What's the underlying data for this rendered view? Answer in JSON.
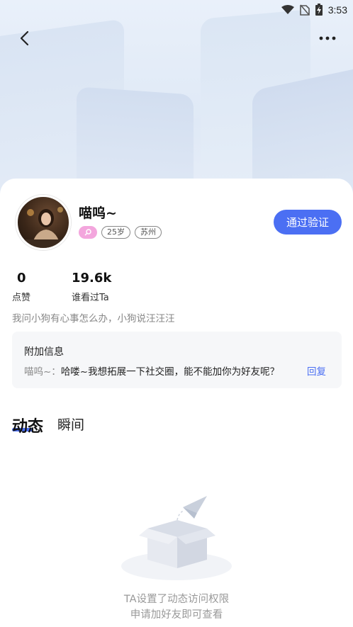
{
  "status_bar": {
    "time": "3:53"
  },
  "profile": {
    "nickname": "喵呜~",
    "age_tag": "25岁",
    "city_tag": "苏州",
    "bio": "我问小狗有心事怎么办，小狗说汪汪汪"
  },
  "actions": {
    "verify_label": "通过验证"
  },
  "stats": [
    {
      "value": "0",
      "label": "点赞"
    },
    {
      "value": "19.6k",
      "label": "谁看过Ta"
    }
  ],
  "extra_info": {
    "title": "附加信息",
    "sender": "喵呜~：",
    "message": "哈喽~我想拓展一下社交圈，能不能加你为好友呢？",
    "reply_label": "回复"
  },
  "tabs": [
    {
      "label": "动态",
      "active": true
    },
    {
      "label": "瞬间",
      "active": false
    }
  ],
  "empty_state": {
    "line1": "TA设置了动态访问权限",
    "line2": "申请加好友即可查看"
  },
  "colors": {
    "accent": "#4b6ff3",
    "gender_tag": "#f3a6dd"
  }
}
